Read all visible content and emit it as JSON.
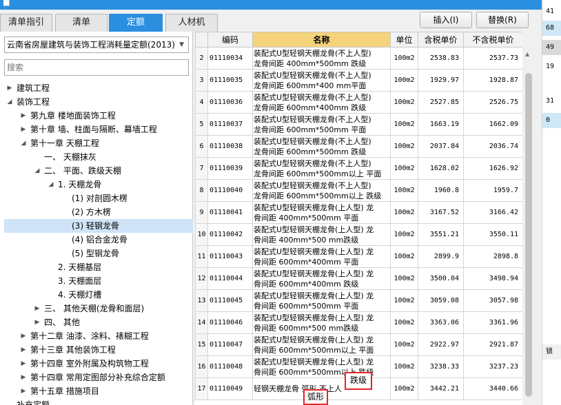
{
  "tabs": [
    {
      "label": "清单指引",
      "active": false
    },
    {
      "label": "清单",
      "active": false
    },
    {
      "label": "定额",
      "active": true
    },
    {
      "label": "人材机",
      "active": false
    }
  ],
  "toolbar": {
    "insert_label": "插入(I)",
    "replace_label": "替换(R)"
  },
  "quota_selector": {
    "value": "云南省房屋建筑与装饰工程消耗量定额(2013)"
  },
  "search": {
    "placeholder": "搜索"
  },
  "tree": [
    {
      "label": "建筑工程",
      "expanded": false,
      "selected": false
    },
    {
      "label": "装饰工程",
      "expanded": true,
      "selected": false
    },
    {
      "label": "第九章 楼地面装饰工程",
      "expanded": false,
      "selected": false
    },
    {
      "label": "第十章 墙、柱面与隔断、幕墙工程",
      "expanded": false,
      "selected": false
    },
    {
      "label": "第十一章 天棚工程",
      "expanded": true,
      "selected": false
    },
    {
      "label": "一、 天棚抹灰",
      "expanded": null,
      "selected": false
    },
    {
      "label": "二、 平面、跌级天棚",
      "expanded": true,
      "selected": false
    },
    {
      "label": "1. 天棚龙骨",
      "expanded": true,
      "selected": false
    },
    {
      "label": "(1) 对剖圆木楞",
      "expanded": null,
      "selected": false
    },
    {
      "label": "(2) 方木楞",
      "expanded": null,
      "selected": false
    },
    {
      "label": "(3) 轻钢龙骨",
      "expanded": null,
      "selected": true
    },
    {
      "label": "(4) 铝合金龙骨",
      "expanded": null,
      "selected": false
    },
    {
      "label": "(5) 型钢龙骨",
      "expanded": null,
      "selected": false
    },
    {
      "label": "2. 天棚基层",
      "expanded": null,
      "selected": false
    },
    {
      "label": "3. 天棚面层",
      "expanded": null,
      "selected": false
    },
    {
      "label": "4. 天棚灯槽",
      "expanded": null,
      "selected": false
    },
    {
      "label": "三、 其他天棚(龙骨和面层)",
      "expanded": false,
      "selected": false
    },
    {
      "label": "四、 其他",
      "expanded": false,
      "selected": false
    },
    {
      "label": "第十二章 油漆、涂料、裱糊工程",
      "expanded": false,
      "selected": false
    },
    {
      "label": "第十三章 其他装饰工程",
      "expanded": false,
      "selected": false
    },
    {
      "label": "第十四章 室外附属及构筑物工程",
      "expanded": false,
      "selected": false
    },
    {
      "label": "第十四章 常用定图部分补充综合定额",
      "expanded": false,
      "selected": false
    },
    {
      "label": "第十五章 措施项目",
      "expanded": false,
      "selected": false
    },
    {
      "label": "补充定额",
      "expanded": null,
      "selected": false
    }
  ],
  "table": {
    "headers": {
      "code": "编码",
      "name": "名称",
      "unit": "单位",
      "tax_price": "含税单价",
      "notax_price": "不含税单价"
    },
    "rows": [
      {
        "no": "2",
        "code": "01110034",
        "name": "装配式U型轻钢天棚龙骨(不上人型)\n龙骨间距 400mm*500mm 跌级",
        "unit": "100m2",
        "tax": "2538.83",
        "notax": "2537.73"
      },
      {
        "no": "3",
        "code": "01110035",
        "name": "装配式U型轻钢天棚龙骨(不上人型)\n龙骨间距 600mm*400 mm平面",
        "unit": "100m2",
        "tax": "1929.97",
        "notax": "1928.87"
      },
      {
        "no": "4",
        "code": "01110036",
        "name": "装配式U型轻钢天棚龙骨(不上人型)\n龙骨间距 600mm*400mm 跌级",
        "unit": "100m2",
        "tax": "2527.85",
        "notax": "2526.75"
      },
      {
        "no": "5",
        "code": "01110037",
        "name": "装配式U型轻钢天棚龙骨(不上人型)\n龙骨间距 600mm*500mm 平面",
        "unit": "100m2",
        "tax": "1663.19",
        "notax": "1662.09"
      },
      {
        "no": "6",
        "code": "01110038",
        "name": "装配式U型轻钢天棚龙骨(不上人型)\n龙骨间距 600mm*500mm 跌级",
        "unit": "100m2",
        "tax": "2037.84",
        "notax": "2036.74"
      },
      {
        "no": "7",
        "code": "01110039",
        "name": "装配式U型轻钢天棚龙骨(不上人型)\n龙骨间距 600mm*500mm以上 平面",
        "unit": "100m2",
        "tax": "1628.02",
        "notax": "1626.92"
      },
      {
        "no": "8",
        "code": "01110040",
        "name": "装配式U型轻钢天棚龙骨(不上人型)\n龙骨间距 600mm*500mm以上 跌级",
        "unit": "100m2",
        "tax": "1960.8",
        "notax": "1959.7"
      },
      {
        "no": "9",
        "code": "01110041",
        "name": "装配式U型轻钢天棚龙骨(上人型) 龙\n骨间距 400mm*500mm 平面",
        "unit": "100m2",
        "tax": "3167.52",
        "notax": "3166.42"
      },
      {
        "no": "10",
        "code": "01110042",
        "name": "装配式U型轻钢天棚龙骨(上人型) 龙\n骨间距 400mm*500 mm跌级",
        "unit": "100m2",
        "tax": "3551.21",
        "notax": "3550.11"
      },
      {
        "no": "11",
        "code": "01110043",
        "name": "装配式U型轻钢天棚龙骨(上人型) 龙\n骨间距 600mm*400mm 平面",
        "unit": "100m2",
        "tax": "2899.9",
        "notax": "2898.8"
      },
      {
        "no": "12",
        "code": "01110044",
        "name": "装配式U型轻钢天棚龙骨(上人型) 龙\n骨间距 600mm*400mm 跌级",
        "unit": "100m2",
        "tax": "3500.04",
        "notax": "3498.94"
      },
      {
        "no": "13",
        "code": "01110045",
        "name": "装配式U型轻钢天棚龙骨(上人型) 龙\n骨间距 600mm*500mm 平面",
        "unit": "100m2",
        "tax": "3059.08",
        "notax": "3057.98"
      },
      {
        "no": "14",
        "code": "01110046",
        "name": "装配式U型轻钢天棚龙骨(上人型) 龙\n骨间距 600mm*500 mm跌级",
        "unit": "100m2",
        "tax": "3363.06",
        "notax": "3361.96"
      },
      {
        "no": "15",
        "code": "01110047",
        "name": "装配式U型轻钢天棚龙骨(上人型) 龙\n骨间距 600mm*500mm以上 平面",
        "unit": "100m2",
        "tax": "2922.97",
        "notax": "2921.87"
      },
      {
        "no": "16",
        "code": "01110048",
        "name": "装配式U型轻钢天棚龙骨(上人型) 龙\n骨间距 600mm*500mm以上 跌级",
        "unit": "100m2",
        "tax": "3238.33",
        "notax": "3237.23"
      },
      {
        "no": "17",
        "code": "01110049",
        "name": "轻钢天棚龙骨 弧形 不上人",
        "unit": "100m2",
        "tax": "3442.21",
        "notax": "3440.66"
      }
    ]
  },
  "highlights": {
    "diejian": "跌级",
    "huxing": "弧形"
  },
  "right_panel": {
    "values": [
      "41",
      "68",
      "49",
      "19",
      "31",
      "0"
    ],
    "bottom_label": "锁"
  }
}
